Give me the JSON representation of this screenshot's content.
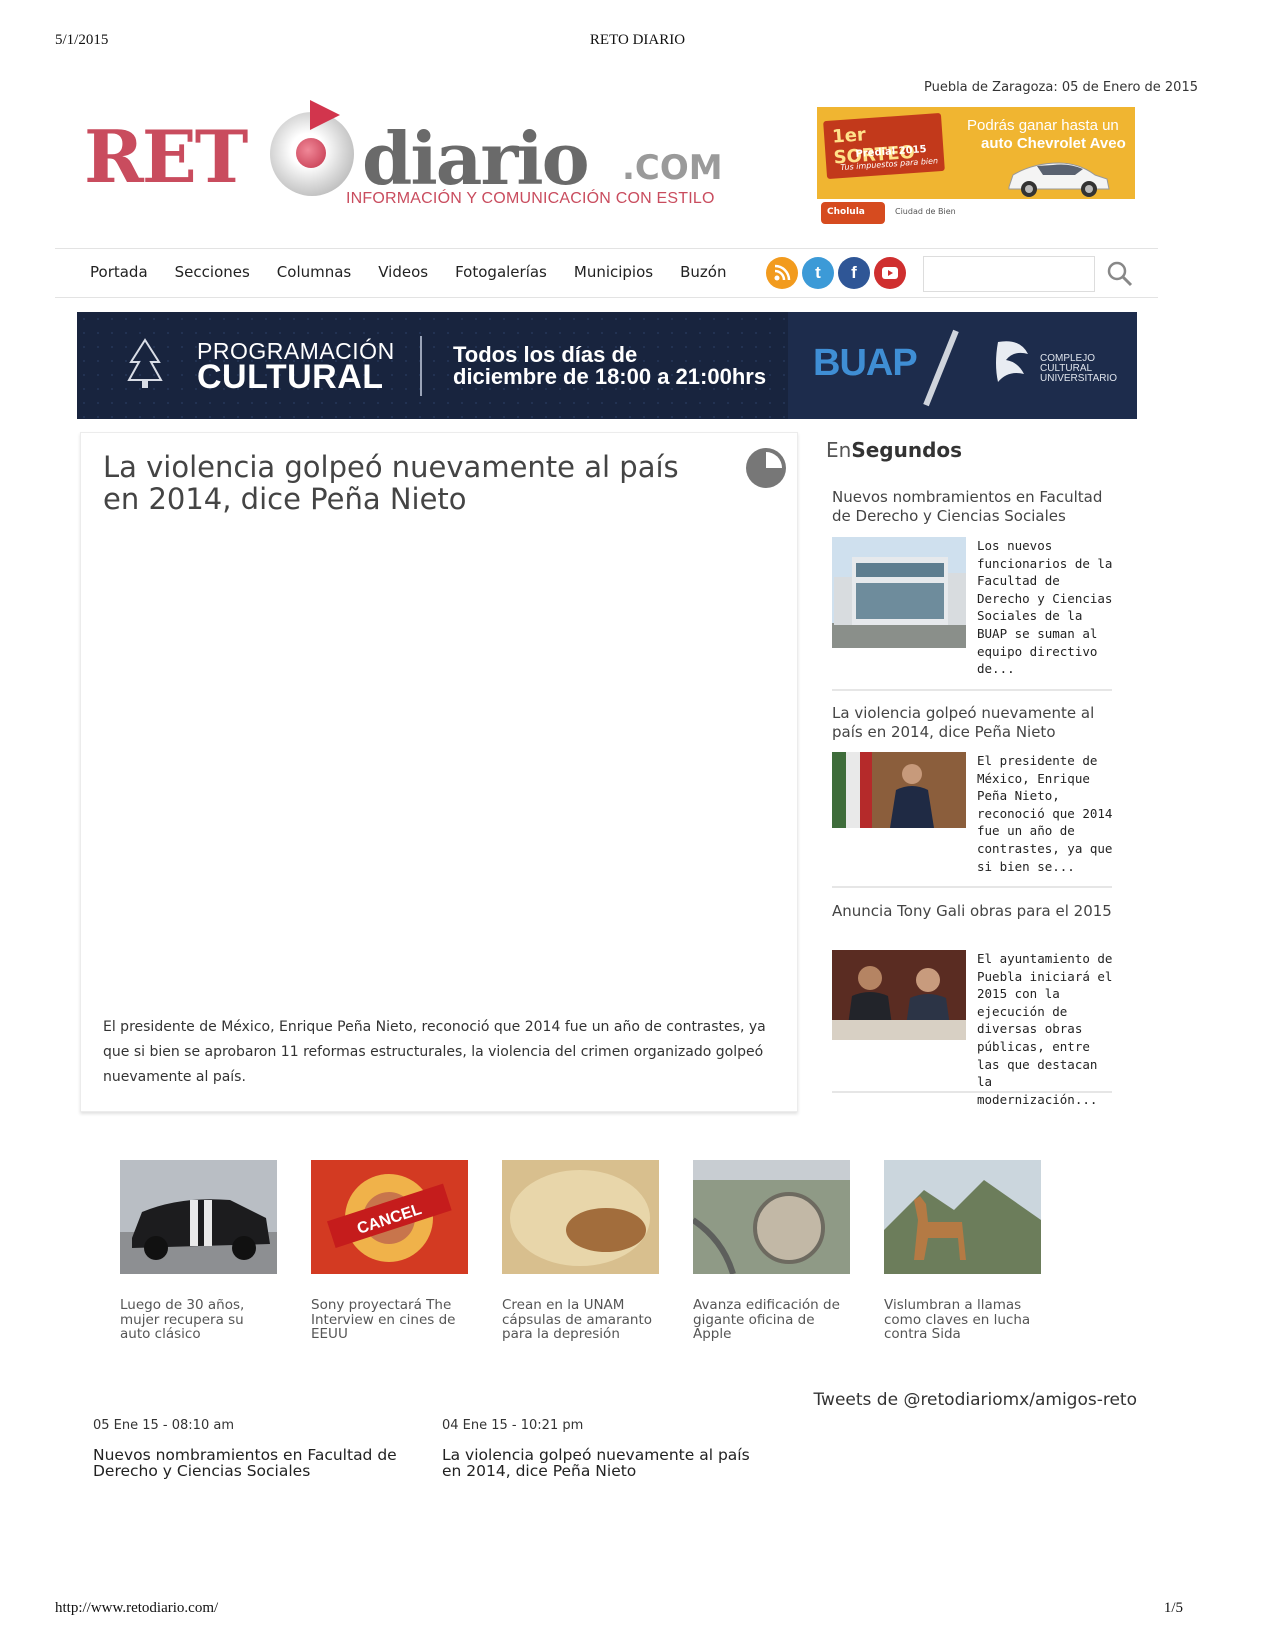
{
  "print": {
    "date": "5/1/2015",
    "title": "RETO DIARIO",
    "url": "http://www.retodiario.com/",
    "page": "1/5"
  },
  "header": {
    "location_label": "Puebla de Zaragoza:",
    "location_date": "05 de Enero de 2015",
    "logo": {
      "reto": "RET",
      "diario": "diario",
      "com": ".COM",
      "tagline": "INFORMACIÓN Y COMUNICACIÓN CON ESTILO"
    },
    "ad": {
      "badge_main": "1er SORTEO",
      "badge_sub": "Predial 2015",
      "badge_small": "Tus impuestos para bien",
      "line1": "Podrás ganar hasta un",
      "line2": "auto Chevrolet Aveo",
      "sponsor1": "Cholula",
      "sponsor2": "Ciudad de Bien"
    }
  },
  "nav": {
    "items": [
      "Portada",
      "Secciones",
      "Columnas",
      "Videos",
      "Fotogalerías",
      "Municipios",
      "Buzón"
    ],
    "social": {
      "rss": "rss-icon",
      "twitter": "t",
      "facebook": "f",
      "youtube": "youtube-icon"
    },
    "search_placeholder": ""
  },
  "banner": {
    "line1": "PROGRAMACIÓN",
    "line2": "CULTURAL",
    "when1": "Todos los días de",
    "when2": "diciembre de 18:00 a 21:00hrs",
    "brand": "BUAP",
    "complex": "COMPLEJO CULTURAL UNIVERSITARIO"
  },
  "article": {
    "title": "La violencia golpeó nuevamente al país en 2014, dice Peña Nieto",
    "body": "El presidente de México, Enrique Peña Nieto, reconoció que 2014 fue un año de contrastes, ya que si bien se aprobaron 11 reformas estructurales, la violencia del crimen organizado golpeó nuevamente al país."
  },
  "sidebar": {
    "heading_light": "En",
    "heading_bold": "Segundos",
    "items": [
      {
        "title": "Nuevos nombramientos en Facultad de Derecho y Ciencias Sociales",
        "desc": "Los nuevos funcionarios de la Facultad de Derecho y Ciencias Sociales de la BUAP se suman al equipo directivo de..."
      },
      {
        "title": "La violencia golpeó nuevamente al país en 2014, dice Peña Nieto",
        "desc": "El presidente de México, Enrique Peña Nieto, reconoció que 2014 fue un año de contrastes, ya que si bien se..."
      },
      {
        "title": "Anuncia Tony Gali obras para el 2015",
        "desc": "El ayuntamiento de Puebla iniciará el 2015 con la ejecución de diversas obras públicas, entre las que destacan la modernización..."
      }
    ]
  },
  "thumbnails": [
    {
      "caption": "Luego de 30 años, mujer recupera su auto clásico"
    },
    {
      "caption": "Sony proyectará The Interview en cines de EEUU"
    },
    {
      "caption": "Crean en la UNAM cápsulas de amaranto para la depresión"
    },
    {
      "caption": "Avanza edificación de gigante oficina de Apple"
    },
    {
      "caption": "Vislumbran a llamas como claves en lucha contra Sida"
    }
  ],
  "tweets_label": "Tweets de @retodiariomx/amigos-reto",
  "bottom_news": [
    {
      "date": "05 Ene 15 - 08:10 am",
      "title": "Nuevos nombramientos en Facultad de Derecho y Ciencias Sociales"
    },
    {
      "date": "04 Ene 15 - 10:21 pm",
      "title": "La violencia golpeó nuevamente al país en 2014, dice Peña Nieto"
    }
  ]
}
